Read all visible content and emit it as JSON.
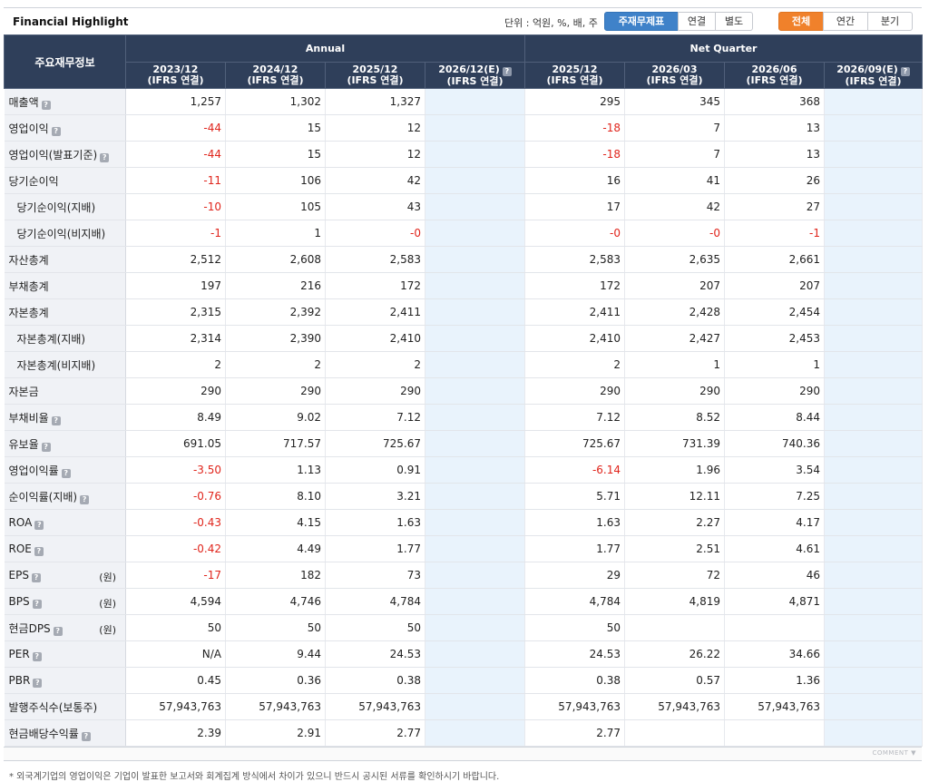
{
  "header": {
    "title": "Financial Highlight",
    "unit_text": "단위 : 억원, %, 배, 주",
    "report_tabs": [
      "주재무제표",
      "연결",
      "별도"
    ],
    "period_tabs": [
      "전체",
      "연간",
      "분기"
    ]
  },
  "table": {
    "corner_label": "주요재무정보",
    "group_annual": "Annual",
    "group_quarter": "Net Quarter",
    "columns": [
      {
        "period": "2023/12",
        "basis": "(IFRS 연결)",
        "estimate": false
      },
      {
        "period": "2024/12",
        "basis": "(IFRS 연결)",
        "estimate": false
      },
      {
        "period": "2025/12",
        "basis": "(IFRS 연결)",
        "estimate": false
      },
      {
        "period": "2026/12(E)",
        "basis": "(IFRS 연결)",
        "estimate": true
      },
      {
        "period": "2025/12",
        "basis": "(IFRS 연결)",
        "estimate": false
      },
      {
        "period": "2026/03",
        "basis": "(IFRS 연결)",
        "estimate": false
      },
      {
        "period": "2026/06",
        "basis": "(IFRS 연결)",
        "estimate": false
      },
      {
        "period": "2026/09(E)",
        "basis": "(IFRS 연결)",
        "estimate": true
      }
    ],
    "rows": [
      {
        "label": "매출액",
        "help": true,
        "sub": false,
        "unit": "",
        "values": [
          "1,257",
          "1,302",
          "1,327",
          "",
          "295",
          "345",
          "368",
          ""
        ]
      },
      {
        "label": "영업이익",
        "help": true,
        "sub": false,
        "unit": "",
        "values": [
          "-44",
          "15",
          "12",
          "",
          "-18",
          "7",
          "13",
          ""
        ]
      },
      {
        "label": "영업이익(발표기준)",
        "help": true,
        "sub": false,
        "unit": "",
        "values": [
          "-44",
          "15",
          "12",
          "",
          "-18",
          "7",
          "13",
          ""
        ]
      },
      {
        "label": "당기순이익",
        "help": false,
        "sub": false,
        "unit": "",
        "values": [
          "-11",
          "106",
          "42",
          "",
          "16",
          "41",
          "26",
          ""
        ]
      },
      {
        "label": "당기순이익(지배)",
        "help": false,
        "sub": true,
        "unit": "",
        "values": [
          "-10",
          "105",
          "43",
          "",
          "17",
          "42",
          "27",
          ""
        ]
      },
      {
        "label": "당기순이익(비지배)",
        "help": false,
        "sub": true,
        "unit": "",
        "values": [
          "-1",
          "1",
          "-0",
          "",
          "-0",
          "-0",
          "-1",
          ""
        ]
      },
      {
        "label": "자산총계",
        "help": false,
        "sub": false,
        "unit": "",
        "values": [
          "2,512",
          "2,608",
          "2,583",
          "",
          "2,583",
          "2,635",
          "2,661",
          ""
        ]
      },
      {
        "label": "부채총계",
        "help": false,
        "sub": false,
        "unit": "",
        "values": [
          "197",
          "216",
          "172",
          "",
          "172",
          "207",
          "207",
          ""
        ]
      },
      {
        "label": "자본총계",
        "help": false,
        "sub": false,
        "unit": "",
        "values": [
          "2,315",
          "2,392",
          "2,411",
          "",
          "2,411",
          "2,428",
          "2,454",
          ""
        ]
      },
      {
        "label": "자본총계(지배)",
        "help": false,
        "sub": true,
        "unit": "",
        "values": [
          "2,314",
          "2,390",
          "2,410",
          "",
          "2,410",
          "2,427",
          "2,453",
          ""
        ]
      },
      {
        "label": "자본총계(비지배)",
        "help": false,
        "sub": true,
        "unit": "",
        "values": [
          "2",
          "2",
          "2",
          "",
          "2",
          "1",
          "1",
          ""
        ]
      },
      {
        "label": "자본금",
        "help": false,
        "sub": false,
        "unit": "",
        "values": [
          "290",
          "290",
          "290",
          "",
          "290",
          "290",
          "290",
          ""
        ]
      },
      {
        "label": "부채비율",
        "help": true,
        "sub": false,
        "unit": "",
        "values": [
          "8.49",
          "9.02",
          "7.12",
          "",
          "7.12",
          "8.52",
          "8.44",
          ""
        ]
      },
      {
        "label": "유보율",
        "help": true,
        "sub": false,
        "unit": "",
        "values": [
          "691.05",
          "717.57",
          "725.67",
          "",
          "725.67",
          "731.39",
          "740.36",
          ""
        ]
      },
      {
        "label": "영업이익률",
        "help": true,
        "sub": false,
        "unit": "",
        "values": [
          "-3.50",
          "1.13",
          "0.91",
          "",
          "-6.14",
          "1.96",
          "3.54",
          ""
        ]
      },
      {
        "label": "순이익률(지배)",
        "help": true,
        "sub": false,
        "unit": "",
        "values": [
          "-0.76",
          "8.10",
          "3.21",
          "",
          "5.71",
          "12.11",
          "7.25",
          ""
        ]
      },
      {
        "label": "ROA",
        "help": true,
        "sub": false,
        "unit": "",
        "values": [
          "-0.43",
          "4.15",
          "1.63",
          "",
          "1.63",
          "2.27",
          "4.17",
          ""
        ]
      },
      {
        "label": "ROE",
        "help": true,
        "sub": false,
        "unit": "",
        "values": [
          "-0.42",
          "4.49",
          "1.77",
          "",
          "1.77",
          "2.51",
          "4.61",
          ""
        ]
      },
      {
        "label": "EPS",
        "help": true,
        "sub": false,
        "unit": "(원)",
        "values": [
          "-17",
          "182",
          "73",
          "",
          "29",
          "72",
          "46",
          ""
        ]
      },
      {
        "label": "BPS",
        "help": true,
        "sub": false,
        "unit": "(원)",
        "values": [
          "4,594",
          "4,746",
          "4,784",
          "",
          "4,784",
          "4,819",
          "4,871",
          ""
        ]
      },
      {
        "label": "현금DPS",
        "help": true,
        "sub": false,
        "unit": "(원)",
        "values": [
          "50",
          "50",
          "50",
          "",
          "50",
          "",
          "",
          ""
        ]
      },
      {
        "label": "PER",
        "help": true,
        "sub": false,
        "unit": "",
        "values": [
          "N/A",
          "9.44",
          "24.53",
          "",
          "24.53",
          "26.22",
          "34.66",
          ""
        ]
      },
      {
        "label": "PBR",
        "help": true,
        "sub": false,
        "unit": "",
        "values": [
          "0.45",
          "0.36",
          "0.38",
          "",
          "0.38",
          "0.57",
          "1.36",
          ""
        ]
      },
      {
        "label": "발행주식수(보통주)",
        "help": false,
        "sub": false,
        "unit": "",
        "values": [
          "57,943,763",
          "57,943,763",
          "57,943,763",
          "",
          "57,943,763",
          "57,943,763",
          "57,943,763",
          ""
        ]
      },
      {
        "label": "현금배당수익률",
        "help": true,
        "sub": false,
        "unit": "",
        "values": [
          "2.39",
          "2.91",
          "2.77",
          "",
          "2.77",
          "",
          "",
          ""
        ]
      }
    ]
  },
  "footer": {
    "comment_label": "COMMENT ▼",
    "note": "* 외국계기업의 영업이익은 기업이 발표한 보고서와 회계집계 방식에서 차이가 있으니 반드시 공시된 서류를 확인하시기 바랍니다."
  },
  "colors": {
    "negative": "#e0251c",
    "estimate_bg": "#e9f3fc",
    "header_bg": "#2f3f5a",
    "active_blue": "#3f82c9",
    "active_orange": "#f0812b"
  }
}
